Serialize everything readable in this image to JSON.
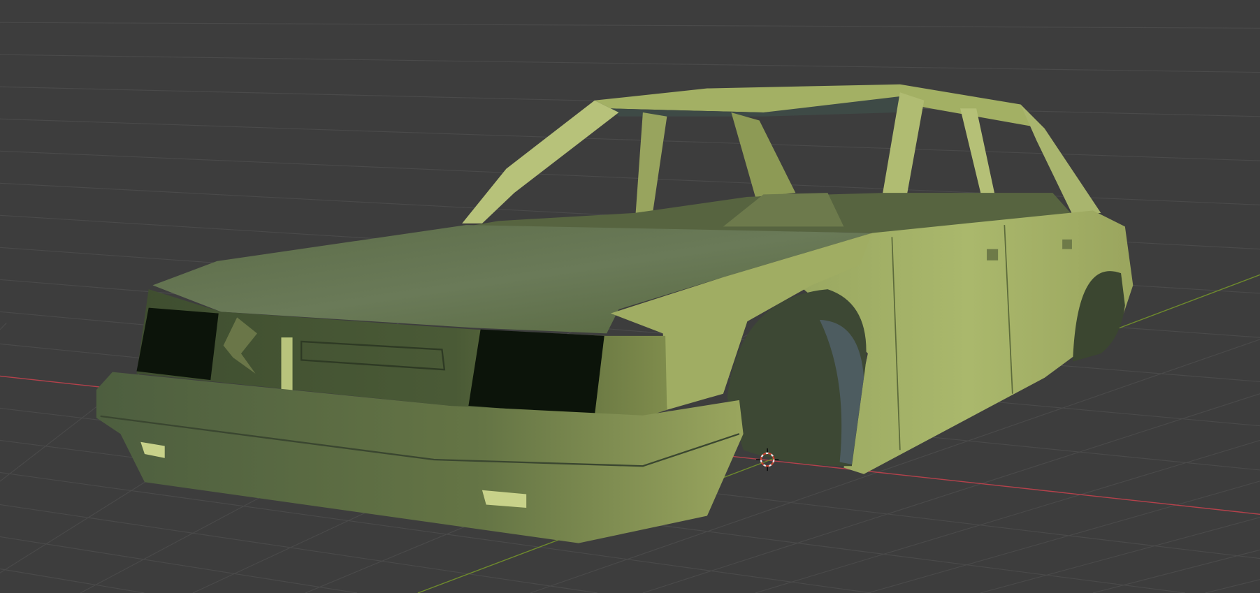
{
  "viewport": {
    "background_color": "#3d3d3d",
    "grid_color": "#4a4a4a",
    "x_axis_color": "#b5414b",
    "y_axis_color": "#6e8a2c",
    "object": {
      "type": "car-body-mesh",
      "material_color": "#a8b467",
      "shadow_color": "#4c5a36",
      "glass_color": "#0c140a"
    },
    "cursor_icon": "3d-cursor-icon"
  }
}
